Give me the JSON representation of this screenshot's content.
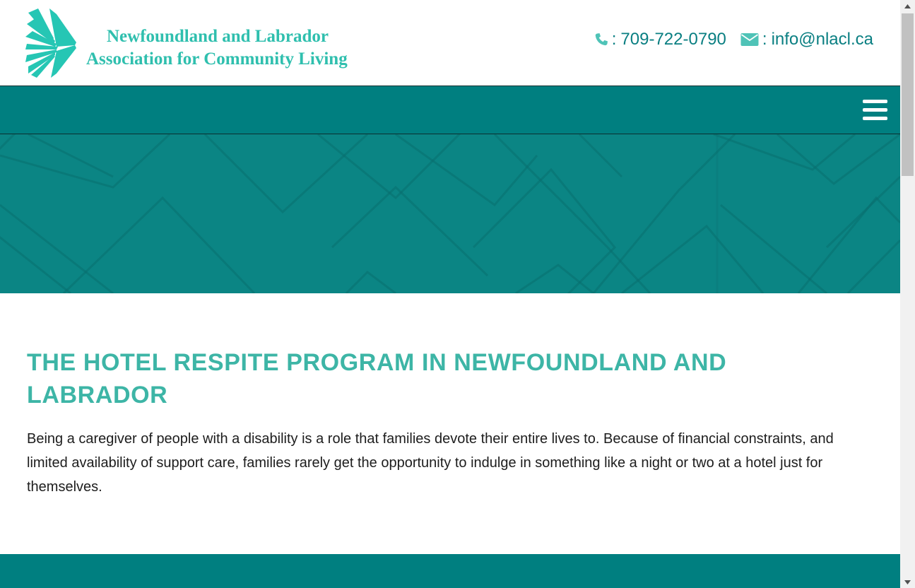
{
  "header": {
    "logo_line1": "Newfoundland and Labrador",
    "logo_line2": "Association for Community Living",
    "logo_icon": "starburst-logo-icon",
    "phone_icon": "phone-icon",
    "phone_sep": ":",
    "phone": "709-722-0790",
    "email_icon": "envelope-icon",
    "email_sep": ":",
    "email": "info@nlacl.ca"
  },
  "nav": {
    "menu_icon": "hamburger-menu-icon"
  },
  "main": {
    "title": "THE HOTEL RESPITE PROGRAM IN NEWFOUNDLAND AND LABRADOR",
    "body": "Being a caregiver of people with a disability is a role that families devote their entire lives to. Because of financial constraints, and limited availability of support care, families rarely get the opportunity to indulge in something like a night or two at a hotel just for themselves."
  },
  "colors": {
    "brand_teal": "#007f80",
    "hero_teal": "#0b8584",
    "heading_teal": "#3db5a6",
    "logo_teal": "#2fbfae",
    "contact_teal": "#0a7f82"
  }
}
